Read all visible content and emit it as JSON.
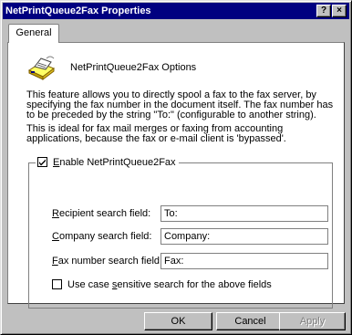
{
  "window": {
    "title": "NetPrintQueue2Fax Properties",
    "help_btn": "?",
    "close_btn": "×"
  },
  "tabs": [
    {
      "label": "General",
      "selected": true
    }
  ],
  "header": {
    "icon": "printer-fax-icon",
    "title": "NetPrintQueue2Fax Options"
  },
  "description": {
    "p1": "This feature allows you to directly spool a fax to the fax server, by specifying the fax number in the document itself. The fax number has to be preceded by the string \"To:\" (configurable to another string).",
    "p2": "This is ideal for fax mail merges or faxing from accounting applications, because the fax or e-mail client is 'bypassed'."
  },
  "group": {
    "enable_label_pre": "",
    "enable_label_u": "E",
    "enable_label_post": "nable NetPrintQueue2Fax",
    "enabled": true,
    "fields": [
      {
        "label_u": "R",
        "label_rest": "ecipient search field:",
        "value": "To:"
      },
      {
        "label_u": "C",
        "label_rest": "ompany search field:",
        "value": "Company:"
      },
      {
        "label_u": "F",
        "label_rest": "ax number search field:",
        "value": "Fax:"
      }
    ],
    "case_label_pre": "Use case ",
    "case_label_u": "s",
    "case_label_post": "ensitive search for the above fields",
    "case_checked": false
  },
  "buttons": {
    "ok": "OK",
    "cancel": "Cancel",
    "apply": "Apply"
  },
  "colors": {
    "titlebar": "#000080",
    "face": "#c0c0c0",
    "panel": "#ffffff"
  }
}
